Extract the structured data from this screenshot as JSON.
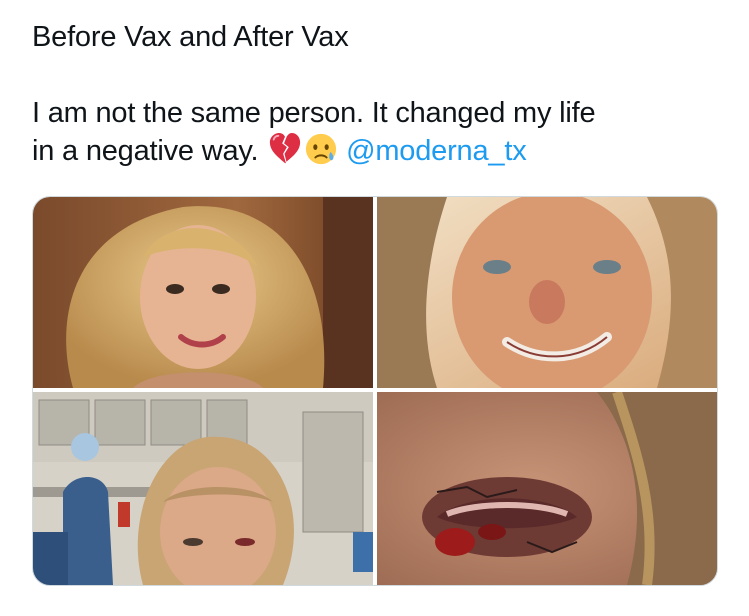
{
  "tweet": {
    "title_line": "Before Vax and After Vax",
    "body_line_1": "I am not the same person. It changed my life",
    "body_line_2": "in a negative way.",
    "emojis": [
      "broken-heart-icon",
      "crying-face-icon"
    ],
    "mention": "@moderna_tx"
  },
  "colors": {
    "text": "#0f1419",
    "mention": "#1d9bf0",
    "border": "#cfd9de"
  },
  "media": {
    "count": 4,
    "layout": "2x2 grid",
    "photos": [
      "photo-before-portrait",
      "photo-after-portrait",
      "photo-hospital-selfie",
      "photo-eye-injury-closeup"
    ]
  }
}
